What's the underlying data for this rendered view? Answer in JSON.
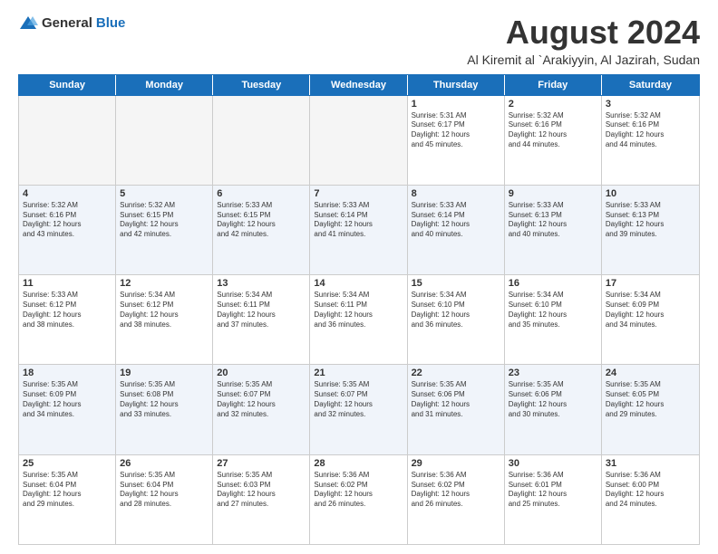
{
  "logo": {
    "general": "General",
    "blue": "Blue"
  },
  "title": "August 2024",
  "location": "Al Kiremit al `Arakiyyin, Al Jazirah, Sudan",
  "weekdays": [
    "Sunday",
    "Monday",
    "Tuesday",
    "Wednesday",
    "Thursday",
    "Friday",
    "Saturday"
  ],
  "weeks": [
    [
      {
        "day": "",
        "text": "",
        "empty": true
      },
      {
        "day": "",
        "text": "",
        "empty": true
      },
      {
        "day": "",
        "text": "",
        "empty": true
      },
      {
        "day": "",
        "text": "",
        "empty": true
      },
      {
        "day": "1",
        "text": "Sunrise: 5:31 AM\nSunset: 6:17 PM\nDaylight: 12 hours\nand 45 minutes."
      },
      {
        "day": "2",
        "text": "Sunrise: 5:32 AM\nSunset: 6:16 PM\nDaylight: 12 hours\nand 44 minutes."
      },
      {
        "day": "3",
        "text": "Sunrise: 5:32 AM\nSunset: 6:16 PM\nDaylight: 12 hours\nand 44 minutes."
      }
    ],
    [
      {
        "day": "4",
        "text": "Sunrise: 5:32 AM\nSunset: 6:16 PM\nDaylight: 12 hours\nand 43 minutes."
      },
      {
        "day": "5",
        "text": "Sunrise: 5:32 AM\nSunset: 6:15 PM\nDaylight: 12 hours\nand 42 minutes."
      },
      {
        "day": "6",
        "text": "Sunrise: 5:33 AM\nSunset: 6:15 PM\nDaylight: 12 hours\nand 42 minutes."
      },
      {
        "day": "7",
        "text": "Sunrise: 5:33 AM\nSunset: 6:14 PM\nDaylight: 12 hours\nand 41 minutes."
      },
      {
        "day": "8",
        "text": "Sunrise: 5:33 AM\nSunset: 6:14 PM\nDaylight: 12 hours\nand 40 minutes."
      },
      {
        "day": "9",
        "text": "Sunrise: 5:33 AM\nSunset: 6:13 PM\nDaylight: 12 hours\nand 40 minutes."
      },
      {
        "day": "10",
        "text": "Sunrise: 5:33 AM\nSunset: 6:13 PM\nDaylight: 12 hours\nand 39 minutes."
      }
    ],
    [
      {
        "day": "11",
        "text": "Sunrise: 5:33 AM\nSunset: 6:12 PM\nDaylight: 12 hours\nand 38 minutes."
      },
      {
        "day": "12",
        "text": "Sunrise: 5:34 AM\nSunset: 6:12 PM\nDaylight: 12 hours\nand 38 minutes."
      },
      {
        "day": "13",
        "text": "Sunrise: 5:34 AM\nSunset: 6:11 PM\nDaylight: 12 hours\nand 37 minutes."
      },
      {
        "day": "14",
        "text": "Sunrise: 5:34 AM\nSunset: 6:11 PM\nDaylight: 12 hours\nand 36 minutes."
      },
      {
        "day": "15",
        "text": "Sunrise: 5:34 AM\nSunset: 6:10 PM\nDaylight: 12 hours\nand 36 minutes."
      },
      {
        "day": "16",
        "text": "Sunrise: 5:34 AM\nSunset: 6:10 PM\nDaylight: 12 hours\nand 35 minutes."
      },
      {
        "day": "17",
        "text": "Sunrise: 5:34 AM\nSunset: 6:09 PM\nDaylight: 12 hours\nand 34 minutes."
      }
    ],
    [
      {
        "day": "18",
        "text": "Sunrise: 5:35 AM\nSunset: 6:09 PM\nDaylight: 12 hours\nand 34 minutes."
      },
      {
        "day": "19",
        "text": "Sunrise: 5:35 AM\nSunset: 6:08 PM\nDaylight: 12 hours\nand 33 minutes."
      },
      {
        "day": "20",
        "text": "Sunrise: 5:35 AM\nSunset: 6:07 PM\nDaylight: 12 hours\nand 32 minutes."
      },
      {
        "day": "21",
        "text": "Sunrise: 5:35 AM\nSunset: 6:07 PM\nDaylight: 12 hours\nand 32 minutes."
      },
      {
        "day": "22",
        "text": "Sunrise: 5:35 AM\nSunset: 6:06 PM\nDaylight: 12 hours\nand 31 minutes."
      },
      {
        "day": "23",
        "text": "Sunrise: 5:35 AM\nSunset: 6:06 PM\nDaylight: 12 hours\nand 30 minutes."
      },
      {
        "day": "24",
        "text": "Sunrise: 5:35 AM\nSunset: 6:05 PM\nDaylight: 12 hours\nand 29 minutes."
      }
    ],
    [
      {
        "day": "25",
        "text": "Sunrise: 5:35 AM\nSunset: 6:04 PM\nDaylight: 12 hours\nand 29 minutes."
      },
      {
        "day": "26",
        "text": "Sunrise: 5:35 AM\nSunset: 6:04 PM\nDaylight: 12 hours\nand 28 minutes."
      },
      {
        "day": "27",
        "text": "Sunrise: 5:35 AM\nSunset: 6:03 PM\nDaylight: 12 hours\nand 27 minutes."
      },
      {
        "day": "28",
        "text": "Sunrise: 5:36 AM\nSunset: 6:02 PM\nDaylight: 12 hours\nand 26 minutes."
      },
      {
        "day": "29",
        "text": "Sunrise: 5:36 AM\nSunset: 6:02 PM\nDaylight: 12 hours\nand 26 minutes."
      },
      {
        "day": "30",
        "text": "Sunrise: 5:36 AM\nSunset: 6:01 PM\nDaylight: 12 hours\nand 25 minutes."
      },
      {
        "day": "31",
        "text": "Sunrise: 5:36 AM\nSunset: 6:00 PM\nDaylight: 12 hours\nand 24 minutes."
      }
    ]
  ]
}
